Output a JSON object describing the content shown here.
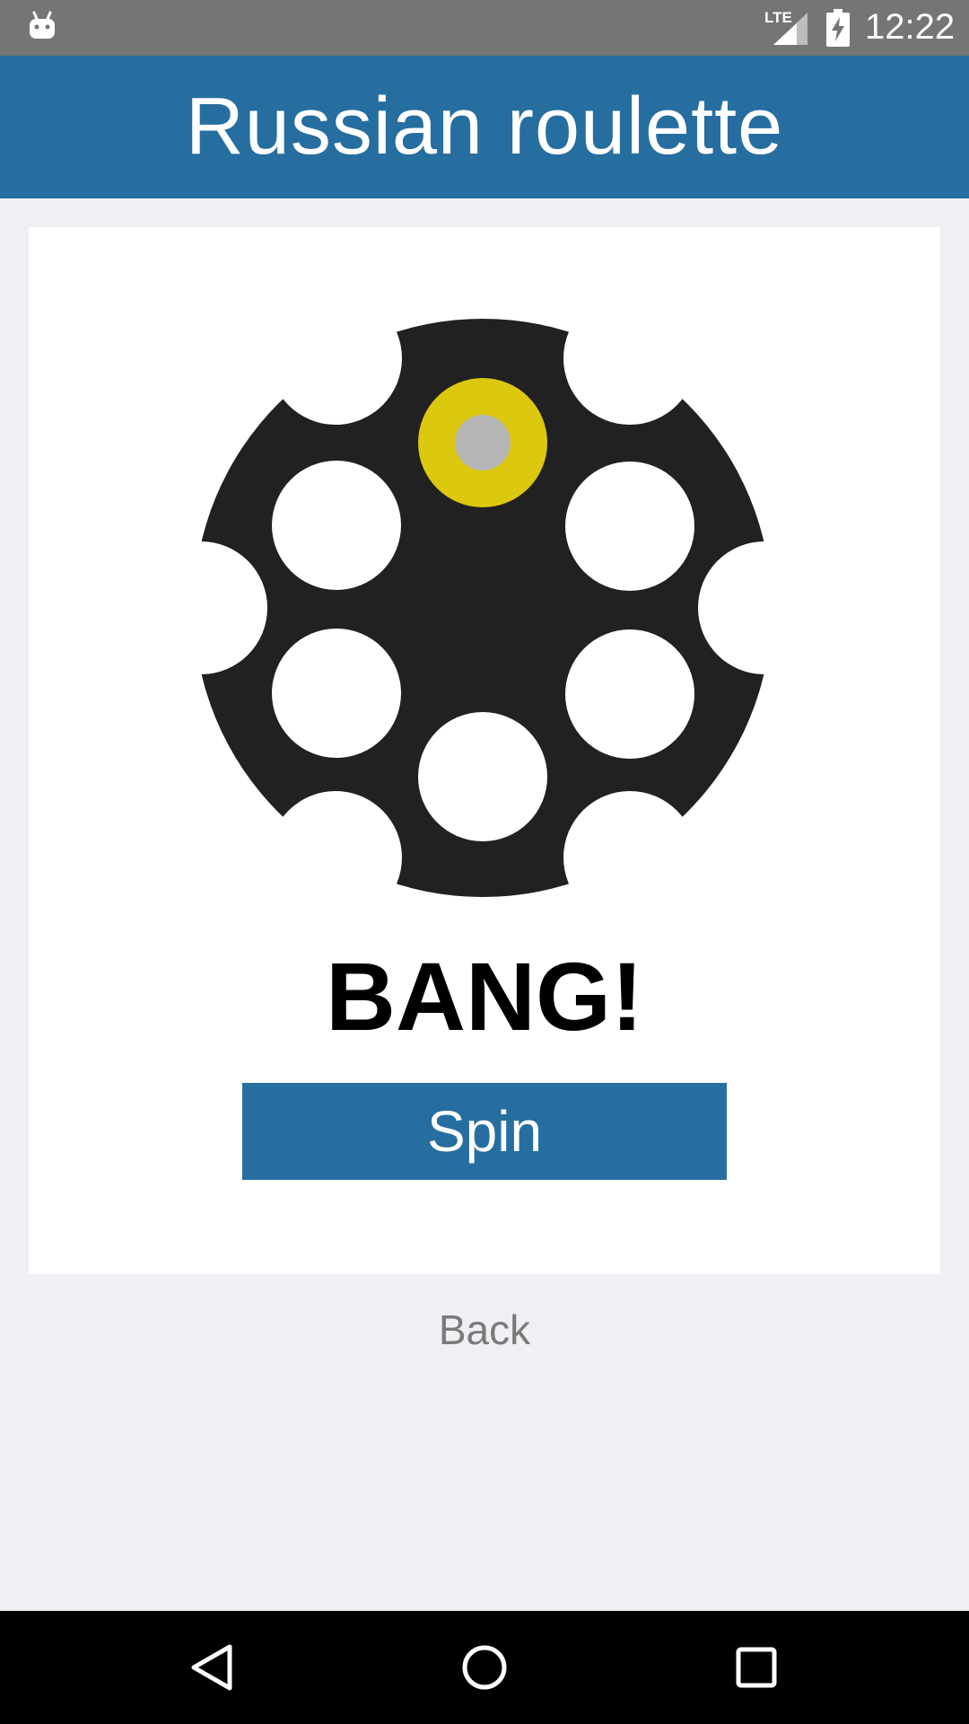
{
  "status_bar": {
    "network": "LTE",
    "time": "12:22",
    "icons": [
      "android-icon",
      "lte-signal-icon",
      "battery-charging-icon"
    ]
  },
  "app_bar": {
    "title": "Russian roulette"
  },
  "game": {
    "cylinder_chambers": 6,
    "loaded_chamber": "top",
    "result": "BANG!",
    "spin_label": "Spin"
  },
  "footer": {
    "back_label": "Back"
  },
  "nav_bar": {
    "icons": [
      "back-triangle-icon",
      "home-circle-icon",
      "recents-square-icon"
    ]
  },
  "colors": {
    "primary": "#266ea0",
    "cylinder": "#212121",
    "bullet_casing": "#dcc80e",
    "bullet_primer": "#b5b5b5",
    "background": "#efeff4"
  }
}
